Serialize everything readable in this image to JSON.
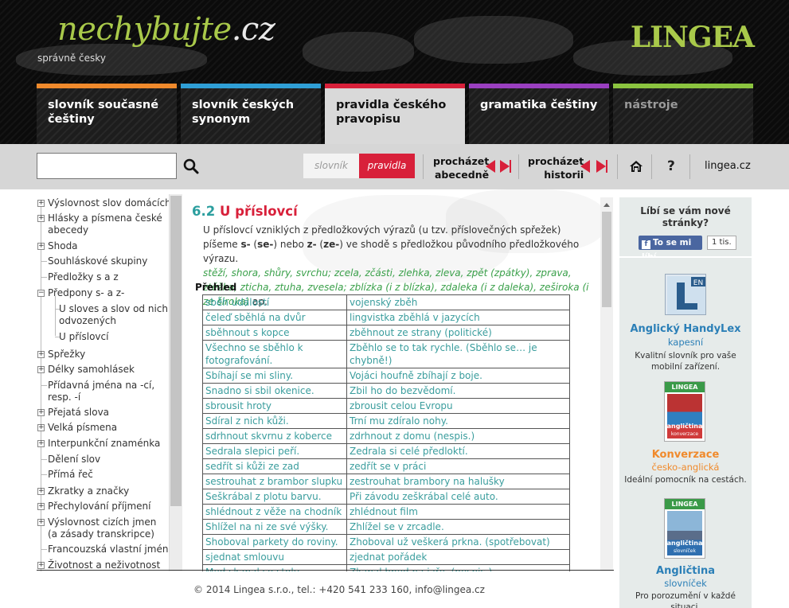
{
  "header": {
    "logo_main": "nechybujte",
    "logo_tld": ".cz",
    "tagline": "správně česky",
    "brand": "LINGEA",
    "tabs": [
      {
        "label": "slovník současné češtiny",
        "color": "#f08a2c"
      },
      {
        "label": "slovník českých synonym",
        "color": "#2f9fd6"
      },
      {
        "label": "pravidla českého pravopisu",
        "color": "#d8203a",
        "active": true
      },
      {
        "label": "gramatika češtiny",
        "color": "#9a3fc0"
      },
      {
        "label": "nástroje",
        "color": "#8bc43f",
        "disabled": true
      }
    ]
  },
  "toolbar": {
    "search_value": "",
    "search_icon": "search-icon",
    "seg_slovnik": "slovník",
    "seg_pravidla": "pravidla",
    "browse_abc_line1": "procházet",
    "browse_abc_line2": "abecedně",
    "browse_hist_line1": "procházet",
    "browse_hist_line2": "historii",
    "home_icon": "home-icon",
    "help_icon": "help-icon",
    "help_label": "?",
    "lingea_link": "lingea.cz",
    "accent": "#d8203a"
  },
  "tree": [
    {
      "label": "Výslovnost slov domácích",
      "type": "plus"
    },
    {
      "label": "Hlásky a písmena české abecedy",
      "type": "plus"
    },
    {
      "label": "Shoda",
      "type": "plus"
    },
    {
      "label": "Souhláskové skupiny",
      "type": "leaf"
    },
    {
      "label": "Předložky s a z",
      "type": "leaf"
    },
    {
      "label": "Předpony s- a z-",
      "type": "minus"
    },
    {
      "label": "U sloves a slov od nich odvozených",
      "type": "child"
    },
    {
      "label": "U příslovcí",
      "type": "child"
    },
    {
      "label": "Spřežky",
      "type": "plus"
    },
    {
      "label": "Délky samohlásek",
      "type": "plus"
    },
    {
      "label": "Přídavná jména na -cí, resp. -í",
      "type": "leaf"
    },
    {
      "label": "Přejatá slova",
      "type": "plus"
    },
    {
      "label": "Velká písmena",
      "type": "plus"
    },
    {
      "label": "Interpunkční znaménka",
      "type": "plus"
    },
    {
      "label": "Dělení slov",
      "type": "leaf"
    },
    {
      "label": "Přímá řeč",
      "type": "leaf"
    },
    {
      "label": "Zkratky a značky",
      "type": "plus"
    },
    {
      "label": "Přechylování příjmení",
      "type": "plus"
    },
    {
      "label": "Výslovnost cizích jmen (a zásady transkripce)",
      "type": "plus"
    },
    {
      "label": "Francouzská vlastní jména",
      "type": "leaf"
    },
    {
      "label": "Životnost a neživotnost",
      "type": "plus"
    }
  ],
  "content": {
    "section_number": "6.2",
    "section_title": "U příslovcí",
    "intro_1": "U příslovcí vzniklých z předložkových výrazů (u tzv. příslovečných spřežek) píšeme ",
    "intro_s": "s-",
    "intro_2": " (",
    "intro_se": "se-",
    "intro_3": ") nebo ",
    "intro_z": "z-",
    "intro_4": " (",
    "intro_ze": "ze-",
    "intro_5": ") ve shodě s předložkou původního předložkového výrazu.",
    "examples_line": "stěží, shora, shůry, svrchu; zcela, zčásti, zlehka, zleva, zpět (zpátky), zprava, ztěžka, zticha, ztuha, zvesela; zblízka (i z blízka), zdaleka (i z daleka), zeširoka (i ze široka)",
    "examples_tail": " ap.",
    "overview_label": "Přehled",
    "table": [
      [
        "sběh událostí",
        "vojenský zběh"
      ],
      [
        "čeleď sběhlá na dvůr",
        "lingvistka zběhlá v jazycích"
      ],
      [
        "sběhnout s kopce",
        "zběhnout ze strany (politické)"
      ],
      [
        "Všechno se sběhlo k fotografování.",
        "Zběhlo se to tak rychle. (Sběhlo se… je chybně!)"
      ],
      [
        "Sbíhají se mi sliny.",
        "Vojáci houfně zbíhají z boje."
      ],
      [
        "Snadno si sbil okenice.",
        "Zbil ho do bezvědomí."
      ],
      [
        "sbrousit hroty",
        "zbrousit celou Evropu"
      ],
      [
        "Sdíral z nich kůži.",
        "Trní mu zdíralo nohy."
      ],
      [
        "sdrhnout skvrnu z koberce",
        "zdrhnout z domu (nespis.)"
      ],
      [
        "Sedrala slepici peří.",
        "Zedrala si celé předloktí."
      ],
      [
        "sedřít si kůži ze zad",
        "zedřít se v práci"
      ],
      [
        "sestrouhat z brambor slupku",
        "zestrouhat brambory na halušky"
      ],
      [
        "Seškrábal z plotu barvu.",
        "Při závodu zeškrábal celé auto."
      ],
      [
        "shlédnout z věže na chodník",
        "zhlédnout film"
      ],
      [
        "Shlížel na ni ze své výšky.",
        "Zhlížel se v zrcadle."
      ],
      [
        "Shoboval parkety do roviny.",
        "Zhoboval už veškerá prkna. (spotřebovat)"
      ],
      [
        "sjednat smlouvu",
        "zjednat pořádek"
      ],
      [
        "Med skapal se stolu.",
        "Zkapal hned na jaře. (nespis.)"
      ]
    ]
  },
  "rail": {
    "like_question": "Líbí se vám nové stránky?",
    "fb_label": "To se mi líbí",
    "fb_count": "1 tis.",
    "products": [
      {
        "name": "Anglický HandyLex",
        "sub": "kapesní",
        "desc": "Kvalitní slovník pro vaše mobilní zařízení.",
        "badge": "EN"
      },
      {
        "name": "Konverzace",
        "sub": "česko-anglická",
        "desc": "Ideální pomocník na cestách.",
        "cover_brand": "LINGEA",
        "cover_title": "angličtina",
        "cover_sub": "konverzace"
      },
      {
        "name": "Angličtina",
        "sub": "slovníček",
        "desc": "Pro porozumění v každé situaci.",
        "cover_brand": "LINGEA",
        "cover_title": "angličtina",
        "cover_sub": "slovníček"
      }
    ]
  },
  "footer": {
    "text": "© 2014 Lingea s.r.o., tel.: +420 541 233 160, info@lingea.cz"
  }
}
